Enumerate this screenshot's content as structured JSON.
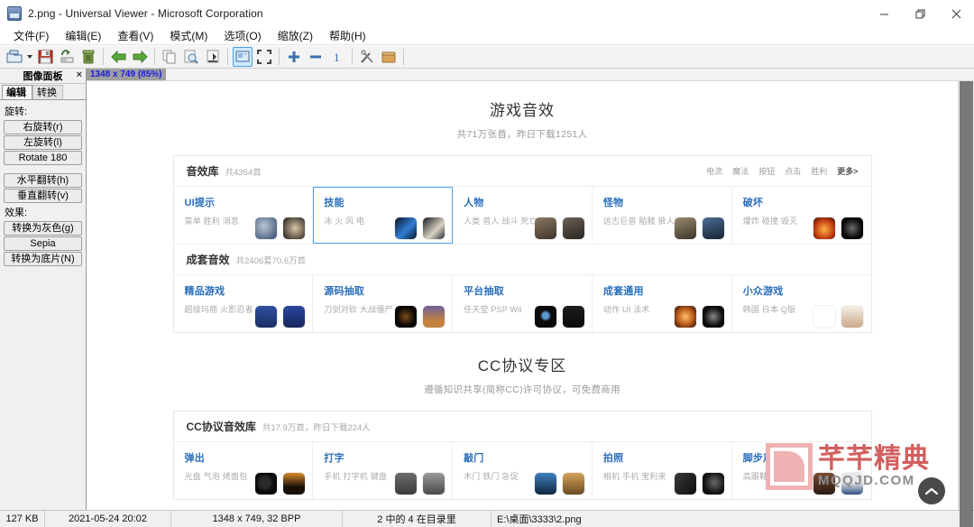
{
  "window": {
    "title": "2.png - Universal Viewer - Microsoft Corporation",
    "icon": "image-file-icon",
    "minimize": "minimize-icon",
    "maximize": "maximize-icon",
    "close": "close-icon"
  },
  "menubar": [
    {
      "label": "文件(F)"
    },
    {
      "label": "编辑(E)"
    },
    {
      "label": "查看(V)"
    },
    {
      "label": "模式(M)"
    },
    {
      "label": "选项(O)"
    },
    {
      "label": "缩放(Z)"
    },
    {
      "label": "帮助(H)"
    }
  ],
  "toolbar": [
    {
      "name": "open-icon"
    },
    {
      "name": "open-dropdown-caret"
    },
    {
      "name": "save-icon"
    },
    {
      "name": "save-as-icon"
    },
    {
      "name": "delete-icon"
    },
    {
      "name": "separator"
    },
    {
      "name": "back-arrow-icon"
    },
    {
      "name": "forward-arrow-icon"
    },
    {
      "name": "separator"
    },
    {
      "name": "copy-icon"
    },
    {
      "name": "find-icon"
    },
    {
      "name": "export-icon"
    },
    {
      "name": "separator"
    },
    {
      "name": "fit-window-icon"
    },
    {
      "name": "fullscreen-icon"
    },
    {
      "name": "separator"
    },
    {
      "name": "zoom-in-icon"
    },
    {
      "name": "zoom-out-icon"
    },
    {
      "name": "zoom-actual-icon"
    },
    {
      "name": "separator"
    },
    {
      "name": "tools-icon"
    },
    {
      "name": "plugins-icon"
    }
  ],
  "dock": {
    "title": "图像面板",
    "close": "×",
    "tabs": [
      {
        "label": "编辑",
        "active": true
      },
      {
        "label": "转换",
        "active": false
      }
    ],
    "rotate_label": "旋转:",
    "rotate_buttons": [
      {
        "label": "右旋转(r)"
      },
      {
        "label": "左旋转(l)"
      },
      {
        "label": "Rotate 180"
      }
    ],
    "flip_buttons": [
      {
        "label": "水平翻转(h)"
      },
      {
        "label": "垂直翻转(v)"
      }
    ],
    "effects_label": "效果:",
    "effect_buttons": [
      {
        "label": "转换为灰色(g)"
      },
      {
        "label": "Sepia"
      },
      {
        "label": "转换为底片(N)"
      }
    ]
  },
  "dimension_bar": {
    "text": "1348 x 749 (85%)"
  },
  "page": {
    "hero": {
      "title": "游戏音效",
      "subtitle": "共71万张首，昨日下载1251人"
    },
    "sections": [
      {
        "title": "音效库",
        "count": "共4354首",
        "tags": [
          "电流",
          "魔法",
          "按钮",
          "点击",
          "胜利"
        ],
        "more": "更多>",
        "cards": [
          {
            "title": "UI提示",
            "tags": "菜单 胜利 消息",
            "selected": false,
            "thumbs": [
              "#4e6e9e",
              "#3a2a20"
            ]
          },
          {
            "title": "技能",
            "tags": "冰 火 风 电",
            "selected": true,
            "thumbs": [
              "#17283f",
              "#2b2b33"
            ]
          },
          {
            "title": "人物",
            "tags": "人类 兽人 战斗 死亡",
            "selected": false,
            "thumbs": [
              "#6a5b4a",
              "#4a4238"
            ]
          },
          {
            "title": "怪物",
            "tags": "远古巨兽 骷髅 狼人",
            "selected": false,
            "thumbs": [
              "#6e6052",
              "#2c3e55"
            ]
          },
          {
            "title": "破坏",
            "tags": "爆炸 碰撞 毁灭",
            "selected": false,
            "thumbs": [
              "#b8471c",
              "#151515"
            ]
          }
        ]
      },
      {
        "title": "成套音效",
        "count": "共2406套70.6万首",
        "tags": [],
        "more": "",
        "cards": [
          {
            "title": "精品游戏",
            "tags": "超级玛丽 火影忍者",
            "selected": false,
            "thumbs": [
              "#3a5aa8",
              "#2e4a8a"
            ]
          },
          {
            "title": "源码抽取",
            "tags": "刀剑对砍 大战僵尸",
            "selected": false,
            "thumbs": [
              "#110f0d",
              "#6a5a8d"
            ]
          },
          {
            "title": "平台抽取",
            "tags": "任天堂 PSP Wii",
            "selected": false,
            "thumbs": [
              "#0d0d0d",
              "#111111"
            ]
          },
          {
            "title": "成套通用",
            "tags": "动作 UI 法术",
            "selected": false,
            "thumbs": [
              "#c4701a",
              "#1b1b1b"
            ]
          },
          {
            "title": "小众游戏",
            "tags": "韩国 日本 Q版",
            "selected": false,
            "thumbs": [
              "#ffffff",
              "#f2ece4"
            ]
          }
        ]
      }
    ],
    "hero2": {
      "title": "CC协议专区",
      "subtitle": "遵循知识共享(简称CC)许可协议，可免费商用"
    },
    "sections2": [
      {
        "title": "CC协议音效库",
        "count": "共17.9万首，昨日下载224人",
        "tags": [],
        "more": "",
        "cards": [
          {
            "title": "弹出",
            "tags": "光盘 气泡 烤面包",
            "selected": false,
            "thumbs": [
              "#0e0e0e",
              "#c07a22"
            ]
          },
          {
            "title": "打字",
            "tags": "手机 打字机 键盘",
            "selected": false,
            "thumbs": [
              "#4b4b4b",
              "#6d6d6d"
            ]
          },
          {
            "title": "敲门",
            "tags": "木门 铁门 急促",
            "selected": false,
            "thumbs": [
              "#2a4a6e",
              "#b88c4a"
            ]
          },
          {
            "title": "拍照",
            "tags": "相机 手机 宝利来",
            "selected": false,
            "thumbs": [
              "#1a1a1a",
              "#2b2b2b"
            ]
          },
          {
            "title": "脚步声",
            "tags": "高跟鞋 拖鞋 凉水鞋",
            "selected": false,
            "thumbs": [
              "#5a3a2a",
              "#2a4266"
            ]
          }
        ]
      }
    ],
    "watermark": {
      "cn": "芊芊精典",
      "en": "MQQJD.COM"
    },
    "gotop": "scroll-to-top-icon"
  },
  "statusbar": {
    "size": "127 KB",
    "date": "2021-05-24 20:02",
    "dimensions": "1348 x 749, 32 BPP",
    "index": "2 中的 4 在目录里",
    "path": "E:\\桌面\\3333\\2.png"
  }
}
